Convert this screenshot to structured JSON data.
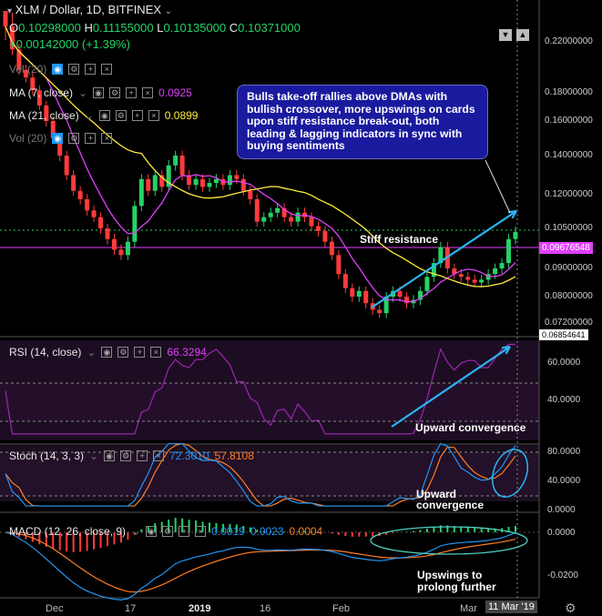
{
  "header": {
    "symbol": "XLM / Dollar, 1D, BITFINEX",
    "o_label": "O",
    "o": "0.10298000",
    "h_label": "H",
    "h": "0.11155000",
    "l_label": "L",
    "l": "0.10135000",
    "c_label": "C",
    "c": "0.10371000",
    "change": "+0.00142000 (+1.39%)"
  },
  "indicators": {
    "vol": "Vol (20)",
    "ma7": "MA (7, close)",
    "ma7_val": "0.0925",
    "ma21": "MA (21, close)",
    "ma21_val": "0.0899",
    "vol2": "Vol (20)",
    "rsi": "RSI (14, close)",
    "rsi_val": "66.3294",
    "stoch": "Stoch (14, 3, 3)",
    "stoch_k": "72.3010",
    "stoch_d": "57.8108",
    "macd": "MACD (12, 26, close, 9)",
    "macd_a": "0.0019",
    "macd_b": "0.0023",
    "macd_c": "0.0004"
  },
  "callout": "Bulls take-off rallies above DMAs with bullish crossover, more upswings on cards upon stiff resistance break-out, both leading & lagging indicators in sync with buying sentiments",
  "annotations": {
    "resistance": "Stiff resistance",
    "rsi_conv": "Upward convergence",
    "stoch_conv_1": "Upward",
    "stoch_conv_2": "convergence",
    "macd_1": "Upswings to",
    "macd_2": "prolong further"
  },
  "price_axis": {
    "ticks": [
      "0.22000000",
      "0.18000000",
      "0.16000000",
      "0.14000000",
      "0.12000000",
      "0.10500000",
      "0.09000000",
      "0.08000000",
      "0.07200000"
    ],
    "badge_current": "0.09676548",
    "badge_low": "0.06854641"
  },
  "rsi_axis": [
    "60.0000",
    "40.0000"
  ],
  "stoch_axis": [
    "80.0000",
    "40.0000",
    "0.0000"
  ],
  "macd_axis": [
    "0.0000",
    "-0.0200"
  ],
  "x_axis": [
    "Dec",
    "17",
    "2019",
    "16",
    "Feb",
    "Mar"
  ],
  "x_current": "11 Mar '19",
  "colors": {
    "up": "#25d366",
    "down": "#ff3b3b",
    "ma7": "#e040fb",
    "ma21": "#ffeb3b",
    "rsi": "#9c27b0",
    "stoch_k": "#2196f3",
    "stoch_d": "#ff7f27",
    "arrow": "#29b6f6"
  },
  "chart_data": {
    "type": "candlestick",
    "title": "XLM / Dollar, 1D, BITFINEX",
    "close_series": [
      0.225,
      0.214,
      0.198,
      0.192,
      0.182,
      0.171,
      0.16,
      0.15,
      0.14,
      0.13,
      0.122,
      0.118,
      0.113,
      0.11,
      0.105,
      0.101,
      0.097,
      0.095,
      0.1,
      0.115,
      0.128,
      0.122,
      0.13,
      0.124,
      0.135,
      0.14,
      0.13,
      0.125,
      0.128,
      0.124,
      0.126,
      0.128,
      0.125,
      0.13,
      0.128,
      0.122,
      0.118,
      0.108,
      0.11,
      0.112,
      0.114,
      0.11,
      0.108,
      0.112,
      0.11,
      0.106,
      0.104,
      0.1,
      0.095,
      0.088,
      0.083,
      0.08,
      0.082,
      0.078,
      0.076,
      0.075,
      0.08,
      0.082,
      0.08,
      0.078,
      0.079,
      0.082,
      0.087,
      0.092,
      0.098,
      0.09,
      0.088,
      0.087,
      0.086,
      0.085,
      0.086,
      0.088,
      0.09,
      0.092,
      0.101,
      0.1037
    ],
    "ma7_last": 0.0925,
    "ma21_last": 0.0899,
    "resistance_level": 0.0968,
    "ylim": [
      0.068,
      0.23
    ]
  }
}
